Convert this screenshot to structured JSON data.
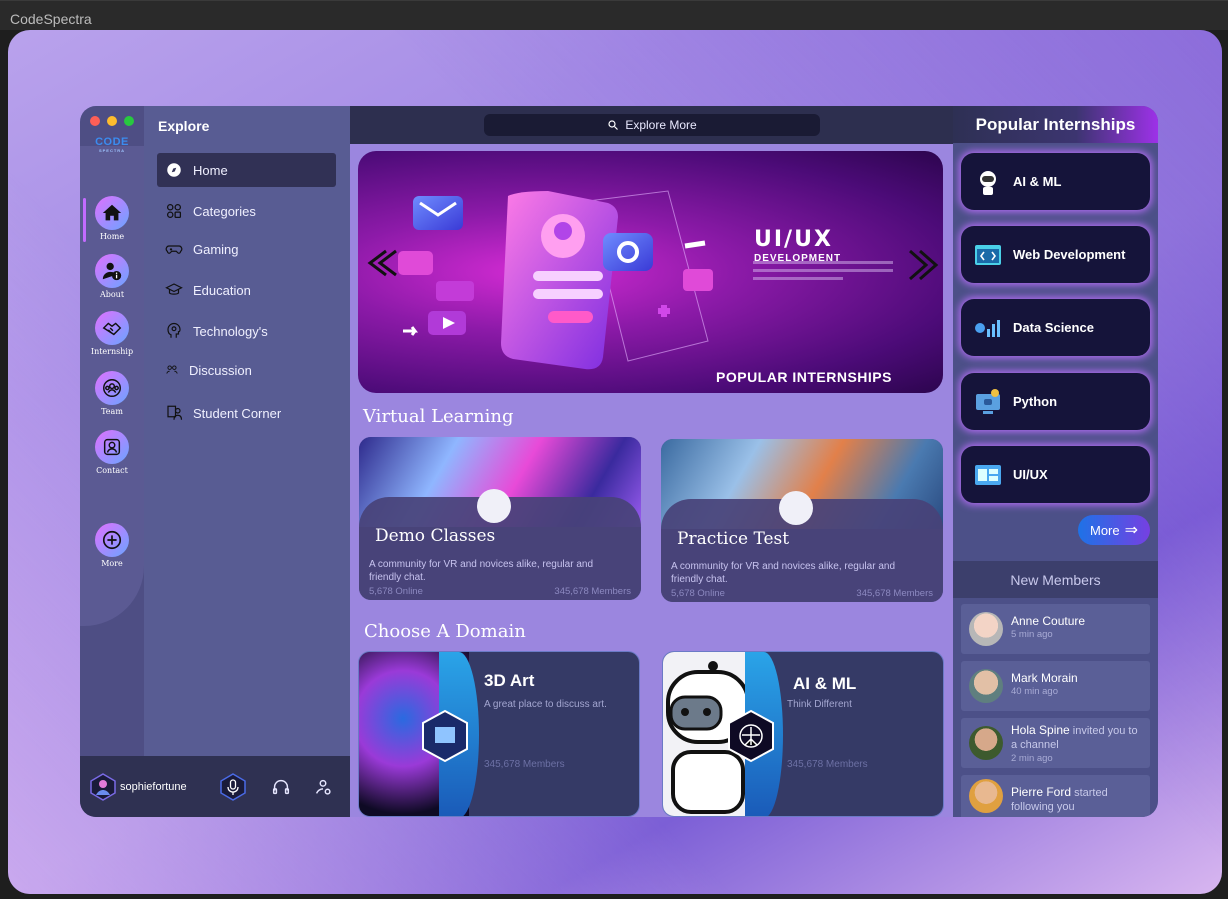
{
  "window": {
    "title": "CodeSpectra"
  },
  "logo": {
    "text": "CODE",
    "sub": "SPECTRA"
  },
  "rail": [
    {
      "label": "Home",
      "icon": "home-icon"
    },
    {
      "label": "About",
      "icon": "user-info-icon"
    },
    {
      "label": "Internship",
      "icon": "handshake-icon"
    },
    {
      "label": "Team",
      "icon": "team-icon"
    },
    {
      "label": "Contact",
      "icon": "contact-icon"
    },
    {
      "label": "More",
      "icon": "plus-circle-icon"
    }
  ],
  "explore": {
    "title": "Explore",
    "items": [
      {
        "label": "Home",
        "icon": "compass-icon"
      },
      {
        "label": "Categories",
        "icon": "categories-icon"
      },
      {
        "label": "Gaming",
        "icon": "gamepad-icon"
      },
      {
        "label": "Education",
        "icon": "graduation-cap-icon"
      },
      {
        "label": "Technology's",
        "icon": "head-gear-icon"
      },
      {
        "label": "Discussion",
        "icon": "discussion-icon"
      },
      {
        "label": "Student Corner",
        "icon": "student-icon"
      }
    ]
  },
  "user": {
    "name": "sophiefortune"
  },
  "search": {
    "label": "Explore More"
  },
  "hero": {
    "title": "UI/UX",
    "subtitle": "DEVELOPMENT",
    "caption": "POPULAR INTERNSHIPS"
  },
  "sections": {
    "virtual": "Virtual Learning",
    "domain": "Choose A Domain"
  },
  "virtual_cards": [
    {
      "title": "Demo Classes",
      "desc": "A community for VR and novices alike, regular and friendly chat.",
      "online": "5,678 Online",
      "members": "345,678 Members"
    },
    {
      "title": "Practice Test",
      "desc": "A community for VR and novices alike, regular and friendly chat.",
      "online": "5,678 Online",
      "members": "345,678 Members"
    }
  ],
  "domain_cards": [
    {
      "title": "3D Art",
      "desc": "A great place to discuss art.",
      "members": "345,678 Members"
    },
    {
      "title": "AI & ML",
      "desc": "Think Different",
      "members": "345,678 Members"
    }
  ],
  "popular": {
    "title": "Popular Internships",
    "items": [
      {
        "label": "AI & ML",
        "icon": "robot-icon"
      },
      {
        "label": "Web Development",
        "icon": "code-window-icon"
      },
      {
        "label": "Data Science",
        "icon": "data-chart-icon"
      },
      {
        "label": "Python",
        "icon": "python-monitor-icon"
      },
      {
        "label": "UI/UX",
        "icon": "ui-layout-icon"
      }
    ],
    "more": "More"
  },
  "new_members": {
    "title": "New Members",
    "items": [
      {
        "name": "Anne Couture",
        "action": "",
        "time": "5 min ago",
        "color": "#e6b8a8"
      },
      {
        "name": "Mark  Morain",
        "action": "",
        "time": "40 min ago",
        "color": "#8fa7a8"
      },
      {
        "name": "Hola Spine",
        "action": " invited you to a channel",
        "time": "2 min ago",
        "color": "#6a8a5a"
      },
      {
        "name": "Pierre Ford",
        "action": " started following you",
        "time": "",
        "color": "#e0a040"
      }
    ]
  }
}
